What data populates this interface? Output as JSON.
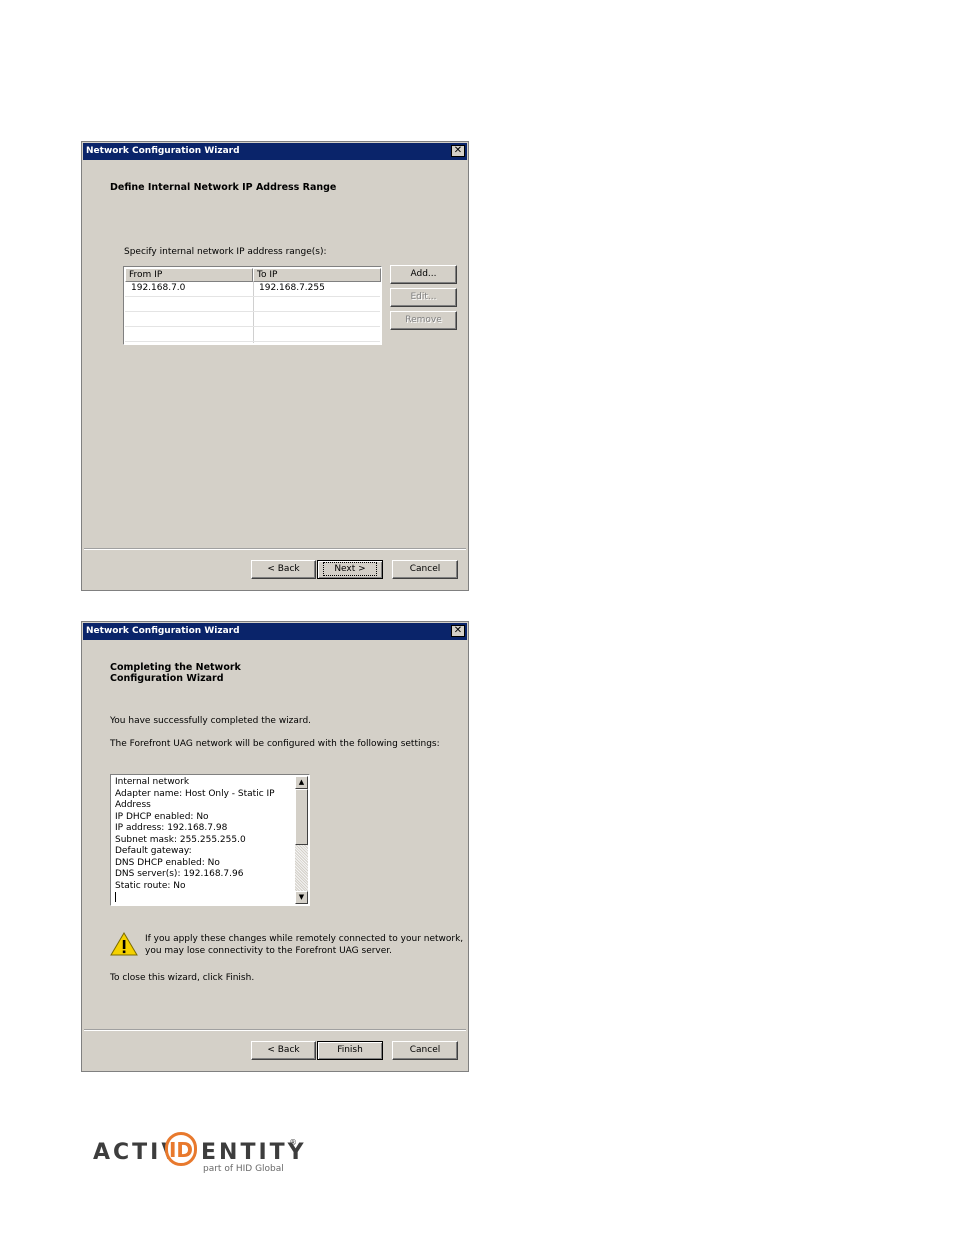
{
  "dialog1": {
    "title": "Network Configuration Wizard",
    "close_label": "✕",
    "heading": "Define Internal Network IP Address Range",
    "instruction": "Specify internal network IP address range(s):",
    "columns": [
      "From IP",
      "To IP"
    ],
    "rows": [
      [
        "192.168.7.0",
        "192.168.7.255"
      ]
    ],
    "add_label": "Add...",
    "edit_label": "Edit...",
    "remove_label": "Remove",
    "back_label": "< Back",
    "next_label": "Next >",
    "cancel_label": "Cancel"
  },
  "dialog2": {
    "title": "Network Configuration Wizard",
    "close_label": "✕",
    "heading": "Completing the Network Configuration Wizard",
    "success_text": "You have successfully completed the wizard.",
    "settings_text": "The Forefront UAG network will be configured with the following settings:",
    "summary_lines": [
      "Internal network",
      "Adapter name: Host Only - Static IP",
      "Address",
      "IP DHCP enabled: No",
      "IP address: 192.168.7.98",
      "Subnet mask: 255.255.255.0",
      "Default gateway:",
      "DNS DHCP enabled: No",
      "DNS server(s): 192.168.7.96",
      "Static route: No"
    ],
    "warning_line1": "If you apply these changes while remotely connected to your network,",
    "warning_line2": "you may lose connectivity to the Forefront UAG server.",
    "close_text": "To close this wizard, click Finish.",
    "back_label": "< Back",
    "finish_label": "Finish",
    "cancel_label": "Cancel"
  },
  "logo": {
    "prefix": "ACTIV",
    "id": "ID",
    "suffix": "ENTITY",
    "registered": "®",
    "tagline": "part of HID Global"
  }
}
